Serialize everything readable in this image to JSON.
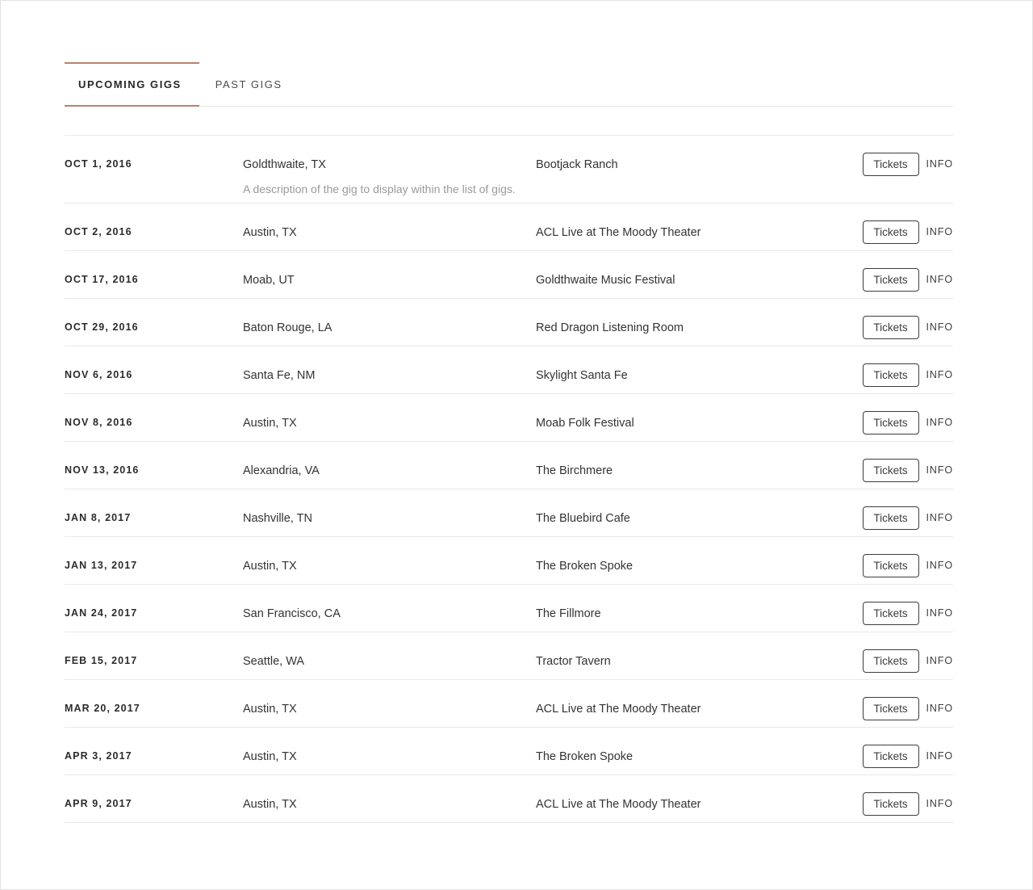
{
  "tabs": [
    {
      "label": "UPCOMING GIGS",
      "active": true
    },
    {
      "label": "PAST GIGS",
      "active": false
    }
  ],
  "actions": {
    "tickets_label": "Tickets",
    "info_label": "INFO"
  },
  "colors": {
    "accent": "#b5846d",
    "text": "#333333",
    "muted": "#9a9a9a",
    "rule": "#e9e9e9"
  },
  "gigs": [
    {
      "date": "OCT 1, 2016",
      "city": "Goldthwaite, TX",
      "venue": "Bootjack Ranch",
      "description": "A description of the gig to display within the list of gigs."
    },
    {
      "date": "OCT 2, 2016",
      "city": "Austin, TX",
      "venue": "ACL Live at The Moody Theater",
      "description": ""
    },
    {
      "date": "OCT 17, 2016",
      "city": "Moab, UT",
      "venue": "Goldthwaite Music Festival",
      "description": ""
    },
    {
      "date": "OCT 29, 2016",
      "city": "Baton Rouge, LA",
      "venue": "Red Dragon Listening Room",
      "description": ""
    },
    {
      "date": "NOV 6, 2016",
      "city": "Santa Fe, NM",
      "venue": "Skylight Santa Fe",
      "description": ""
    },
    {
      "date": "NOV 8, 2016",
      "city": "Austin, TX",
      "venue": "Moab Folk Festival",
      "description": ""
    },
    {
      "date": "NOV 13, 2016",
      "city": "Alexandria, VA",
      "venue": "The Birchmere",
      "description": ""
    },
    {
      "date": "JAN 8, 2017",
      "city": "Nashville, TN",
      "venue": "The Bluebird Cafe",
      "description": ""
    },
    {
      "date": "JAN 13, 2017",
      "city": "Austin, TX",
      "venue": "The Broken Spoke",
      "description": ""
    },
    {
      "date": "JAN 24, 2017",
      "city": "San Francisco, CA",
      "venue": "The Fillmore",
      "description": ""
    },
    {
      "date": "FEB 15, 2017",
      "city": "Seattle, WA",
      "venue": "Tractor Tavern",
      "description": ""
    },
    {
      "date": "MAR 20, 2017",
      "city": "Austin, TX",
      "venue": "ACL Live at The Moody Theater",
      "description": ""
    },
    {
      "date": "APR 3, 2017",
      "city": "Austin, TX",
      "venue": "The Broken Spoke",
      "description": ""
    },
    {
      "date": "APR 9, 2017",
      "city": "Austin, TX",
      "venue": "ACL Live at The Moody Theater",
      "description": ""
    }
  ]
}
